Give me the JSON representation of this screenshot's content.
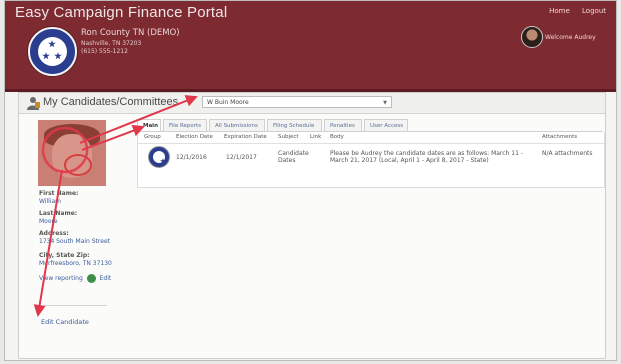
{
  "app": {
    "title": "Easy Campaign Finance Portal",
    "top_links": [
      "Home",
      "Logout"
    ],
    "county_name": "Ron County TN (DEMO)",
    "county_lines": [
      "Nashville, TN 37203",
      "(615) 555-1212"
    ],
    "welcome": "Welcome Audrey"
  },
  "panel": {
    "title": "My Candidates/Committees",
    "selected_candidate": "W Buin Moore"
  },
  "candidate": {
    "fields": [
      {
        "label": "First Name:",
        "value": "William"
      },
      {
        "label": "Last Name:",
        "value": "Moore"
      },
      {
        "label": "Address:",
        "value": "1734 South Main Street"
      },
      {
        "label": "City, State Zip:",
        "value": "Murfreesboro, TN 37130"
      }
    ],
    "view_reporting_label": "View reporting",
    "edit_label": "Edit",
    "edit_candidate_label": "Edit Candidate"
  },
  "tabs": [
    "Main",
    "File Reports",
    "All Submissions",
    "Filing Schedule",
    "Penalties",
    "User Access"
  ],
  "table": {
    "headers": [
      "Group",
      "Election Date",
      "Expiration Date",
      "Subject",
      "Link",
      "Body",
      "Attachments"
    ],
    "rows": [
      {
        "election_date": "12/1/2016",
        "expiration_date": "12/1/2017",
        "subject": "Candidate Dates",
        "body": "Please be Audrey the candidate dates are as follows: March 11 - March 21, 2017 (Local, April 1 - April 8, 2017 - State)",
        "body_link": "March",
        "attachments": "N/A attachments"
      }
    ]
  }
}
